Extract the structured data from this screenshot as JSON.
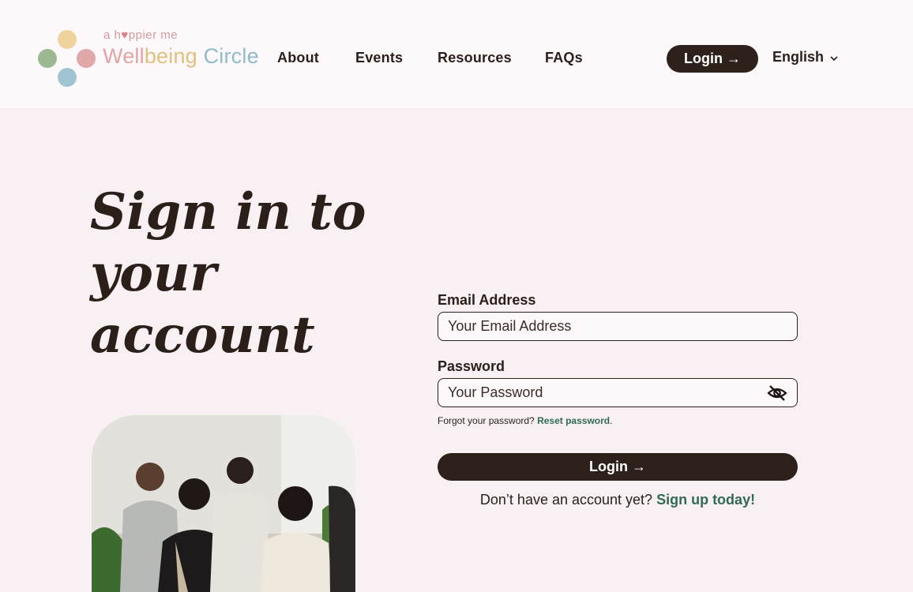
{
  "logo": {
    "tagline_pre": "a h",
    "tagline_heart": "♥",
    "tagline_post": "ppier me",
    "wordmark_1": "Well",
    "wordmark_2": "being",
    "wordmark_3": " Circle",
    "colors": {
      "yellow": "#efd39c",
      "green": "#9bb893",
      "pink": "#e0a8a8",
      "blue": "#9fc5d2"
    }
  },
  "nav": {
    "about": "About",
    "events": "Events",
    "resources": "Resources",
    "faqs": "FAQs"
  },
  "header": {
    "login_label": "Login →",
    "language": "English",
    "language_icon": "chevron-down-icon"
  },
  "headline": {
    "line1": "Sign in to",
    "line2": "your",
    "line3": "account"
  },
  "form": {
    "email_label": "Email Address",
    "email_placeholder": "Your Email Address",
    "email_value": "",
    "password_label": "Password",
    "password_placeholder": "Your Password",
    "password_value": "",
    "password_toggle_icon": "eye-off-icon",
    "forgot_text": "Forgot your password?",
    "reset_link": "Reset password",
    "reset_suffix": ".",
    "login_label": "Login →",
    "signup_prompt": "Don’t have an account yet?",
    "signup_link": "Sign up today!"
  },
  "colors": {
    "page_bg": "#f9f0f3",
    "header_bg": "#fdf8fa",
    "dark": "#2e211b",
    "link_green": "#2f6b52"
  }
}
